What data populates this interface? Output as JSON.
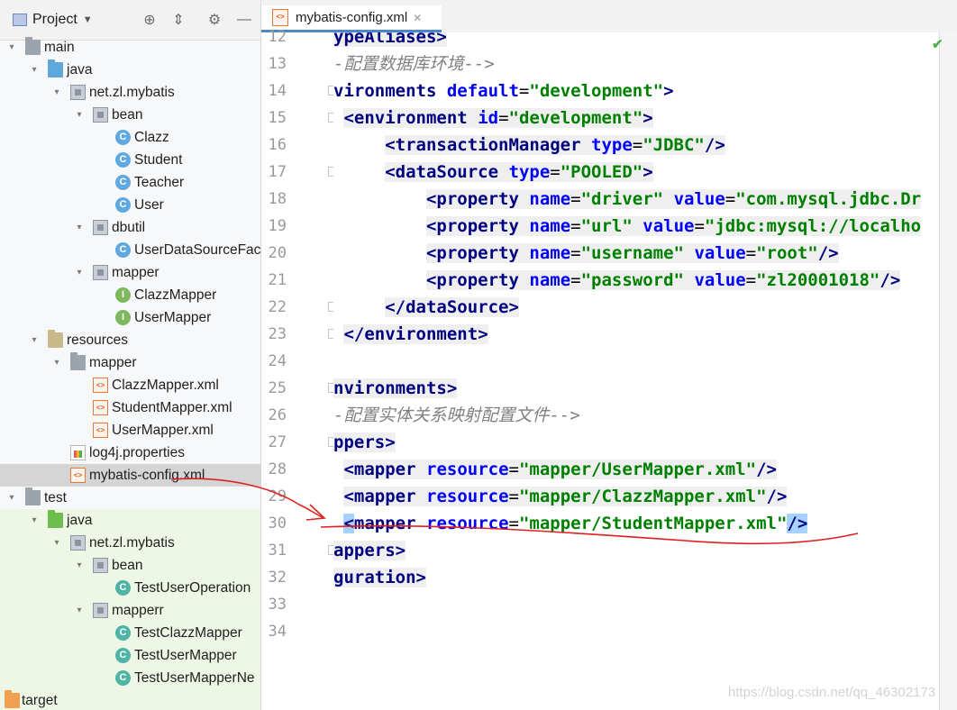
{
  "project_panel": {
    "title": "Project",
    "tree": [
      {
        "label": "main",
        "icon": "folder-icon"
      },
      {
        "label": "java",
        "icon": "source-folder-icon"
      },
      {
        "label": "net.zl.mybatis",
        "icon": "package-icon"
      },
      {
        "label": "bean",
        "icon": "package-icon"
      },
      {
        "label": "Clazz",
        "icon": "class-icon"
      },
      {
        "label": "Student",
        "icon": "class-icon"
      },
      {
        "label": "Teacher",
        "icon": "class-icon"
      },
      {
        "label": "User",
        "icon": "class-icon"
      },
      {
        "label": "dbutil",
        "icon": "package-icon"
      },
      {
        "label": "UserDataSourceFac",
        "icon": "class-icon"
      },
      {
        "label": "mapper",
        "icon": "package-icon"
      },
      {
        "label": "ClazzMapper",
        "icon": "interface-icon"
      },
      {
        "label": "UserMapper",
        "icon": "interface-icon"
      },
      {
        "label": "resources",
        "icon": "resources-folder-icon"
      },
      {
        "label": "mapper",
        "icon": "folder-icon"
      },
      {
        "label": "ClazzMapper.xml",
        "icon": "xml-file-icon"
      },
      {
        "label": "StudentMapper.xml",
        "icon": "xml-file-icon"
      },
      {
        "label": "UserMapper.xml",
        "icon": "xml-file-icon"
      },
      {
        "label": "log4j.properties",
        "icon": "properties-file-icon"
      },
      {
        "label": "mybatis-config.xml",
        "icon": "xml-file-icon"
      },
      {
        "label": "test",
        "icon": "folder-icon"
      },
      {
        "label": "java",
        "icon": "test-source-folder-icon"
      },
      {
        "label": "net.zl.mybatis",
        "icon": "package-icon"
      },
      {
        "label": "bean",
        "icon": "package-icon"
      },
      {
        "label": "TestUserOperation",
        "icon": "test-class-icon"
      },
      {
        "label": "mapperr",
        "icon": "package-icon"
      },
      {
        "label": "TestClazzMapper",
        "icon": "test-class-icon"
      },
      {
        "label": "TestUserMapper",
        "icon": "test-class-icon"
      },
      {
        "label": "TestUserMapperNe",
        "icon": "test-class-icon"
      },
      {
        "label": "target",
        "icon": "excluded-folder-icon"
      }
    ]
  },
  "editor": {
    "tab_label": "mybatis-config.xml",
    "line_numbers": [
      "12",
      "13",
      "14",
      "15",
      "16",
      "17",
      "18",
      "19",
      "20",
      "21",
      "22",
      "23",
      "24",
      "25",
      "26",
      "27",
      "28",
      "29",
      "30",
      "31",
      "32",
      "33",
      "34"
    ],
    "current_line": "30",
    "code": {
      "l12": "ypeAliases>",
      "l13": "-配置数据库环境-->",
      "l14_tag": "vironments",
      "l14_attr": "default",
      "l14_val": "\"development\"",
      "l15_tag": "environment",
      "l15_attr": "id",
      "l15_val": "\"development\"",
      "l16_tag": "transactionManager",
      "l16_attr": "type",
      "l16_val": "\"JDBC\"",
      "l17_tag": "dataSource",
      "l17_attr": "type",
      "l17_val": "\"POOLED\"",
      "l18_tag": "property",
      "l18_a1": "name",
      "l18_v1": "\"driver\"",
      "l18_a2": "value",
      "l18_v2": "\"com.mysql.jdbc.Dr",
      "l19_tag": "property",
      "l19_a1": "name",
      "l19_v1": "\"url\"",
      "l19_a2": "value",
      "l19_v2": "\"jdbc:mysql://localho",
      "l20_tag": "property",
      "l20_a1": "name",
      "l20_v1": "\"username\"",
      "l20_a2": "value",
      "l20_v2": "\"root\"",
      "l21_tag": "property",
      "l21_a1": "name",
      "l21_v1": "\"password\"",
      "l21_a2": "value",
      "l21_v2": "\"zl20001018\"",
      "l22_tag": "/dataSource",
      "l23_tag": "/environment",
      "l25": "nvironments>",
      "l26": "-配置实体关系映射配置文件-->",
      "l27": "ppers>",
      "l28_tag": "mapper",
      "l28_attr": "resource",
      "l28_val": "\"mapper/UserMapper.xml\"",
      "l29_tag": "mapper",
      "l29_attr": "resource",
      "l29_val": "\"mapper/ClazzMapper.xml\"",
      "l30_tag": "mapper",
      "l30_attr": "resource",
      "l30_val": "\"mapper/StudentMapper.xml\"",
      "l31": "appers>",
      "l32": "guration>"
    }
  },
  "watermark": "https://blog.csdn.net/qq_46302173",
  "colors": {
    "tag": "#000080",
    "attr_name": "#0000ff",
    "attr_value": "#008000",
    "comment": "#808080",
    "current_line": "#fffae3",
    "annotation_pen": "#e02020"
  }
}
